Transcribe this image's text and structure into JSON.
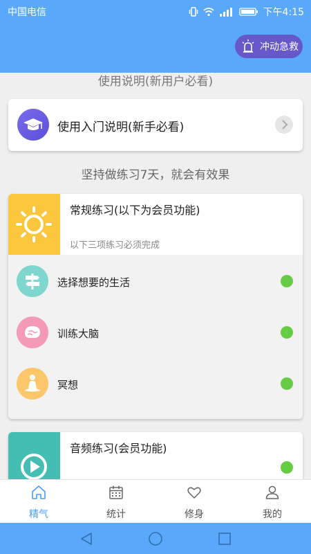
{
  "status_bar": {
    "carrier": "中国电信",
    "time": "下午4:15"
  },
  "header": {
    "emergency_label": "冲动急救"
  },
  "top_hint": "使用说明(新用户必看)",
  "guide": {
    "label": "使用入门说明(新手必看)"
  },
  "motto": "坚持做练习7天，就会有效果",
  "practice": {
    "title": "常规练习(以下为会员功能)",
    "subtitle": "以下三项练习必须完成",
    "items": [
      {
        "label": "选择想要的生活",
        "icon": "signpost-icon",
        "icon_color": "#7fd6ce",
        "completed": true
      },
      {
        "label": "训练大脑",
        "icon": "brain-icon",
        "icon_color": "#f49ab6",
        "completed": true
      },
      {
        "label": "冥想",
        "icon": "meditation-icon",
        "icon_color": "#fcc76a",
        "completed": true
      }
    ]
  },
  "audio": {
    "title": "音频练习(会员功能)",
    "completed": true
  },
  "tabs": [
    {
      "label": "精气",
      "icon": "home-icon",
      "active": true
    },
    {
      "label": "统计",
      "icon": "calendar-icon",
      "active": false
    },
    {
      "label": "修身",
      "icon": "heart-icon",
      "active": false
    },
    {
      "label": "我的",
      "icon": "person-icon",
      "active": false
    }
  ],
  "colors": {
    "accent": "#5aa8f9",
    "emergency": "#6658c9",
    "status_green": "#66cc45",
    "tab_active": "#4a9cf2"
  }
}
